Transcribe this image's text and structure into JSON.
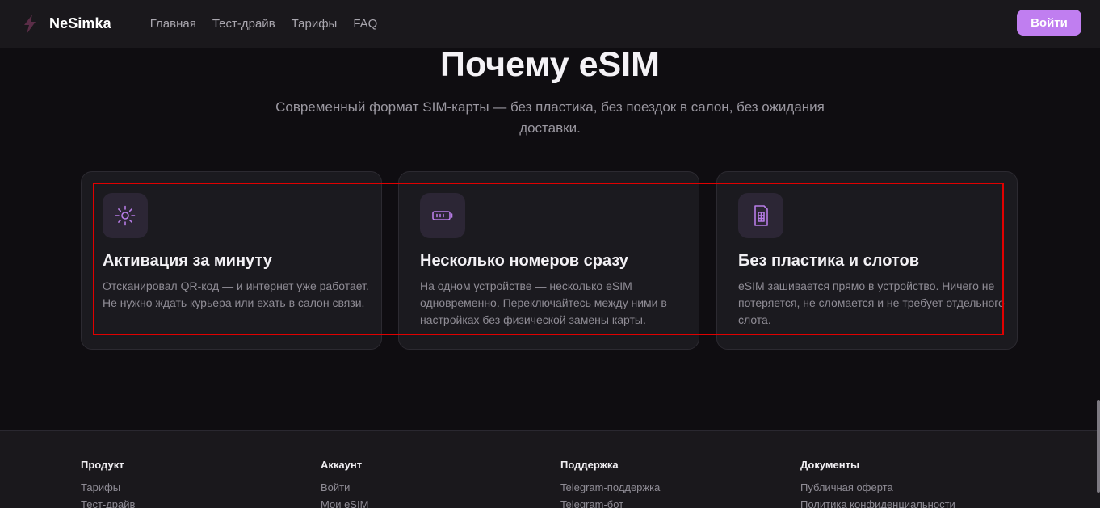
{
  "header": {
    "brand": "NeSimka",
    "logo_icon": "lightning-bolt-icon",
    "nav": [
      "Главная",
      "Тест-драйв",
      "Тарифы",
      "FAQ"
    ],
    "login_label": "Войти",
    "accent_color": "#c07ef0"
  },
  "section": {
    "title": "Почему eSIM",
    "subtitle": "Современный формат SIM-карты — без пластика, без поездок в салон, без ожидания доставки."
  },
  "features": [
    {
      "icon": "sun-icon",
      "title": "Активация за минуту",
      "text": "Отсканировал QR-код — и интернет уже работает. Не нужно ждать курьера или ехать в салон связи."
    },
    {
      "icon": "battery-icon",
      "title": "Несколько номеров сразу",
      "text": "На одном устройстве — несколько eSIM одновременно. Переключайтесь между ними в настройках без физической замены карты."
    },
    {
      "icon": "sim-card-icon",
      "title": "Без пластика и слотов",
      "text": "eSIM зашивается прямо в устройство. Ничего не потеряется, не сломается и не требует отдельного слота."
    }
  ],
  "footer": {
    "columns": [
      {
        "heading": "Продукт",
        "links": [
          "Тарифы",
          "Тест-драйв"
        ]
      },
      {
        "heading": "Аккаунт",
        "links": [
          "Войти",
          "Мои eSIM"
        ]
      },
      {
        "heading": "Поддержка",
        "links": [
          "Telegram-поддержка",
          "Telegram-бот"
        ]
      },
      {
        "heading": "Документы",
        "links": [
          "Публичная оферта",
          "Политика конфиденциальности"
        ]
      }
    ]
  }
}
